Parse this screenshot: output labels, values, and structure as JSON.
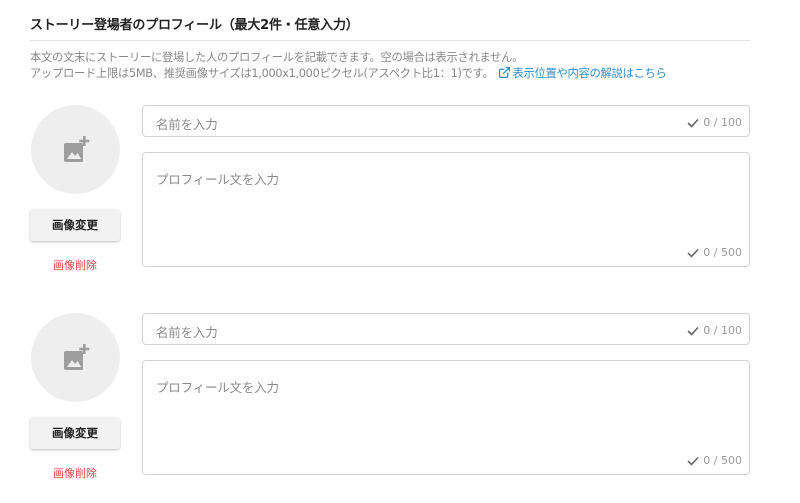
{
  "section": {
    "title": "ストーリー登場者のプロフィール（最大2件・任意入力）",
    "description_line1": "本文の文末にストーリーに登場した人のプロフィールを記載できます。空の場合は表示されません。",
    "description_line2": "アップロード上限は5MB、推奨画像サイズは1,000x1,000ピクセル(アスペクト比1：1)です。",
    "help_link_label": "表示位置や内容の解説はこちら",
    "help_link_icon": "external-link-icon"
  },
  "profiles": [
    {
      "avatar_icon": "add-photo-icon",
      "change_image_label": "画像変更",
      "delete_image_label": "画像削除",
      "name_placeholder": "名前を入力",
      "name_counter": "0 / 100",
      "bio_placeholder": "プロフィール文を入力",
      "bio_counter": "0 / 500"
    },
    {
      "avatar_icon": "add-photo-icon",
      "change_image_label": "画像変更",
      "delete_image_label": "画像削除",
      "name_placeholder": "名前を入力",
      "name_counter": "0 / 100",
      "bio_placeholder": "プロフィール文を入力",
      "bio_counter": "0 / 500"
    }
  ],
  "colors": {
    "link": "#2f8ecb",
    "delete": "#e04848",
    "avatar_bg": "#eeeeee",
    "field_border": "#d4d4d4"
  }
}
